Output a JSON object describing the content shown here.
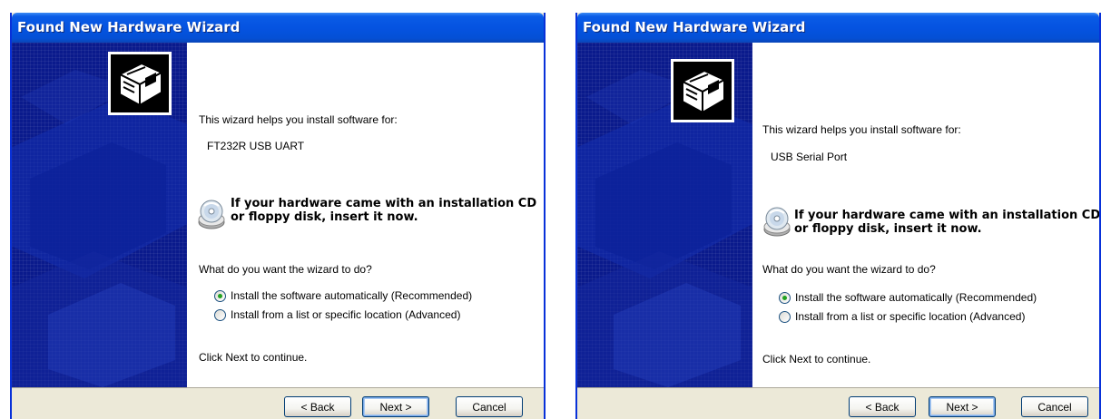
{
  "wizards": [
    {
      "title": "Found New Hardware Wizard",
      "intro": "This wizard helps you install software for:",
      "device": "FT232R USB UART",
      "cd_message_line1": "If your hardware came with an installation CD",
      "cd_message_line2": "or floppy disk, insert it now.",
      "question": "What do you want the wizard to do?",
      "option_auto": "Install the software automatically (Recommended)",
      "option_auto_selected": true,
      "option_advanced": "Install from a list or specific location (Advanced)",
      "continue_text": "Click Next to continue.",
      "back_label": "< Back",
      "next_label": "Next >",
      "cancel_label": "Cancel"
    },
    {
      "title": "Found New Hardware Wizard",
      "intro": "This wizard helps you install software for:",
      "device": "USB Serial Port",
      "cd_message_line1": "If your hardware came with an installation CD",
      "cd_message_line2": "or floppy disk, insert it now.",
      "question": "What do you want the wizard to do?",
      "option_auto": "Install the software automatically (Recommended)",
      "option_auto_selected": true,
      "option_advanced": "Install from a list or specific location (Advanced)",
      "continue_text": "Click Next to continue.",
      "back_label": "< Back",
      "next_label": "Next >",
      "cancel_label": "Cancel"
    }
  ],
  "colors": {
    "titlebar": "#0553e1",
    "side_panel": "#0a1a8c",
    "dialog_face": "#ece9d8",
    "radio_dot": "#21a121"
  },
  "icons": {
    "hardware": "hardware-icon",
    "cd": "cd-icon",
    "radio_selected": "radio-selected-icon",
    "radio_unselected": "radio-unselected-icon"
  }
}
